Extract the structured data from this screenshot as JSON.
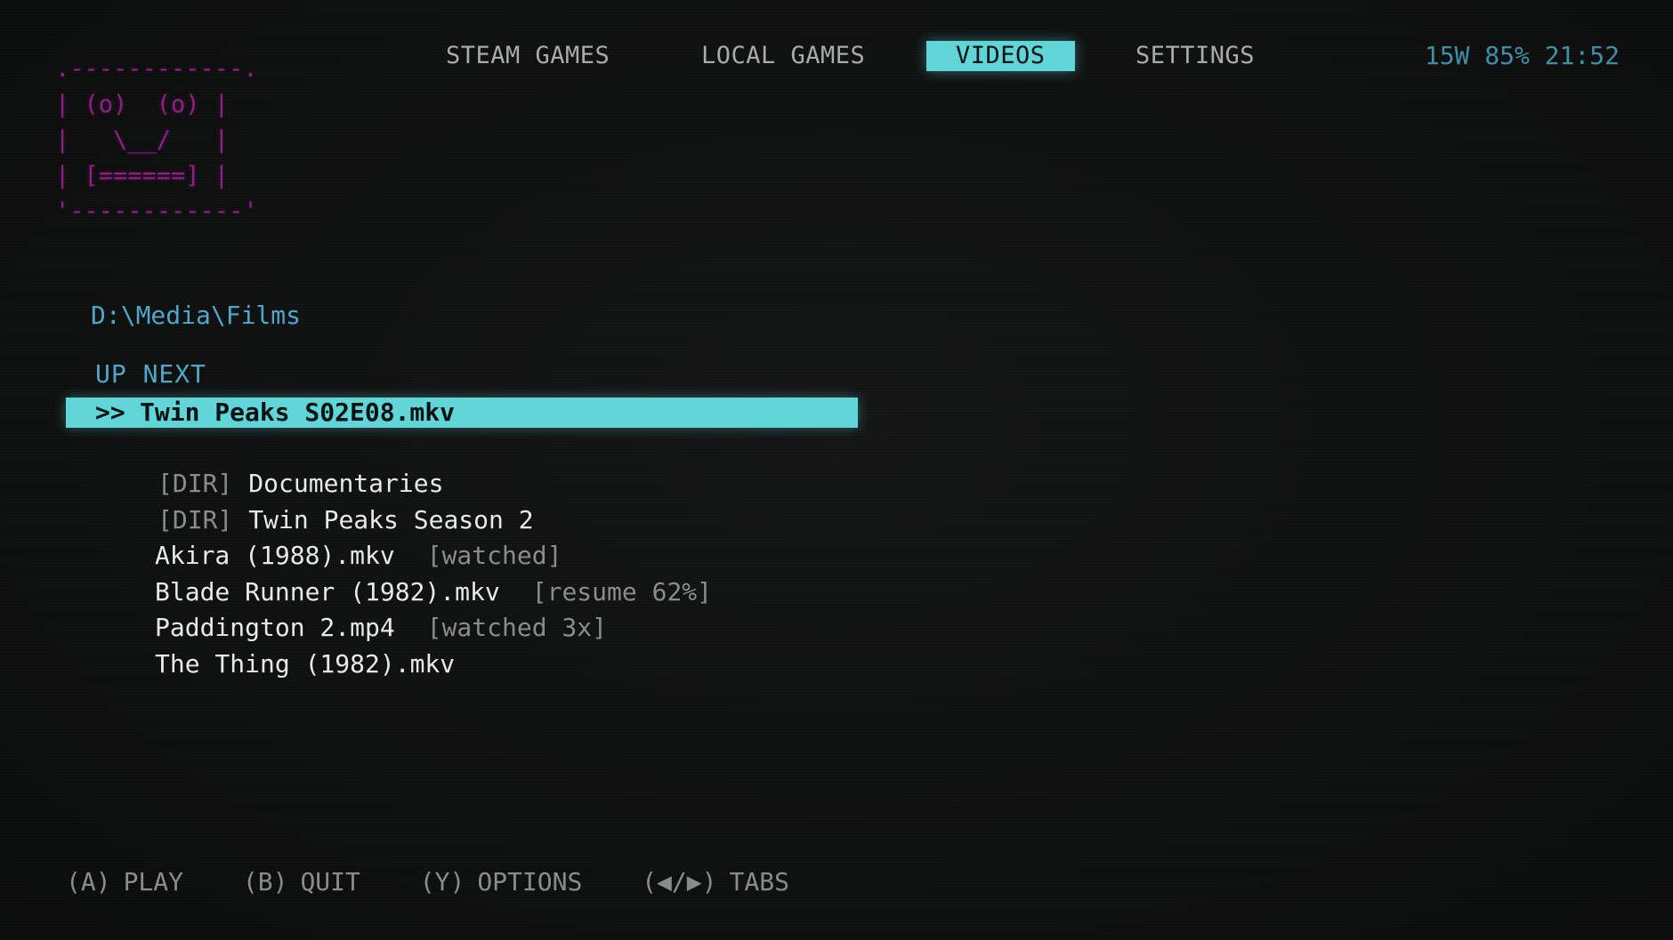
{
  "logo": {
    "art": ".------------.\n| (o)  (o) |\n|   \\__/   |\n| [======] |\n'------------'",
    "color": "#8f1f86"
  },
  "tabs": [
    {
      "label": "STEAM GAMES",
      "active": false
    },
    {
      "label": "LOCAL GAMES",
      "active": false
    },
    {
      "label": "VIDEOS",
      "active": true
    },
    {
      "label": "SETTINGS",
      "active": false
    }
  ],
  "status": "15W 85% 21:52",
  "browser": {
    "path": "D:\\Media\\Films",
    "up_next_label": "UP NEXT",
    "up_next_marker": ">>",
    "up_next_file": "Twin Peaks S02E08.mkv"
  },
  "entries": [
    {
      "tag": "[DIR]",
      "name": "Documentaries",
      "note": ""
    },
    {
      "tag": "[DIR]",
      "name": "Twin Peaks Season 2",
      "note": ""
    },
    {
      "tag": "",
      "name": "Akira (1988).mkv",
      "note": "[watched]"
    },
    {
      "tag": "",
      "name": "Blade Runner (1982).mkv",
      "note": "[resume 62%]"
    },
    {
      "tag": "",
      "name": "Paddington 2.mp4",
      "note": "[watched 3x]"
    },
    {
      "tag": "",
      "name": "The Thing (1982).mkv",
      "note": ""
    }
  ],
  "controls": [
    {
      "key": "(A)",
      "label": "PLAY"
    },
    {
      "key": "(B)",
      "label": "QUIT"
    },
    {
      "key": "(Y)",
      "label": "OPTIONS"
    },
    {
      "key": "(◀/▶)",
      "label": "TABS"
    }
  ],
  "colors": {
    "accent": "#5fd5d7",
    "path": "#4fa6c8",
    "status": "#3e8fa6",
    "muted": "#8a8c8c",
    "text": "#e8e9e9",
    "background": "#0f1010"
  }
}
